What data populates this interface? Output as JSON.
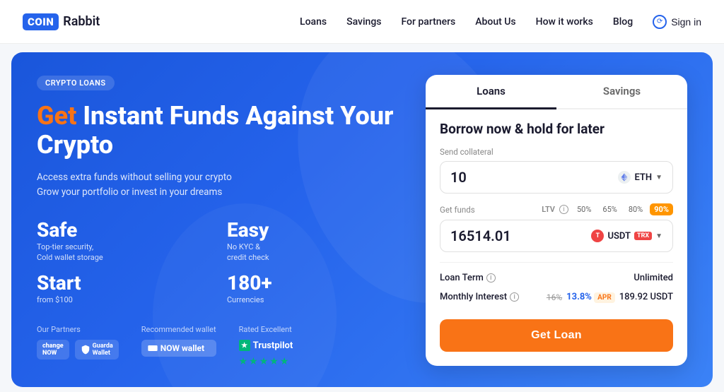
{
  "header": {
    "logo_coin": "COIN",
    "logo_rabbit": "Rabbit",
    "nav": {
      "loans": "Loans",
      "savings": "Savings",
      "for_partners": "For partners",
      "about_us": "About Us",
      "how_it_works": "How it works",
      "blog": "Blog",
      "signin": "Sign in"
    }
  },
  "hero": {
    "badge": "CRYPTO LOANS",
    "title_get": "Get",
    "title_rest": " Instant Funds Against Your Crypto",
    "subtitle_line1": "Access extra funds without selling your crypto",
    "subtitle_line2": "Grow your portfolio or invest in your dreams",
    "features": [
      {
        "big": "Safe",
        "small": "Top-tier security,\nCold wallet storage"
      },
      {
        "big": "Easy",
        "small": "No KYC &\ncredit check"
      },
      {
        "big": "Start",
        "small": "from $100"
      },
      {
        "big": "180+",
        "small": "Currencies"
      }
    ],
    "partners_label": "Our Partners",
    "wallet_label": "Recommended wallet",
    "rated_label": "Rated Excellent",
    "trustpilot": "Trustpilot"
  },
  "card": {
    "tab_loans": "Loans",
    "tab_savings": "Savings",
    "title": "Borrow now & hold for later",
    "collateral_label": "Send collateral",
    "collateral_value": "10",
    "collateral_currency": "ETH",
    "funds_label": "Get funds",
    "ltv_label": "LTV",
    "ltv_options": [
      "50%",
      "65%",
      "80%",
      "90%"
    ],
    "ltv_active": "90%",
    "funds_value": "16514.01",
    "funds_currency": "USDT",
    "funds_currency2": "TRX",
    "loan_term_label": "Loan Term",
    "loan_term_info": "ⓘ",
    "loan_term_value": "Unlimited",
    "monthly_interest_label": "Monthly Interest",
    "monthly_interest_info": "ⓘ",
    "old_rate": "16%",
    "new_rate": "13.8% APR",
    "interest_usdt": "189.92 USDT",
    "get_loan_btn": "Get Loan"
  }
}
